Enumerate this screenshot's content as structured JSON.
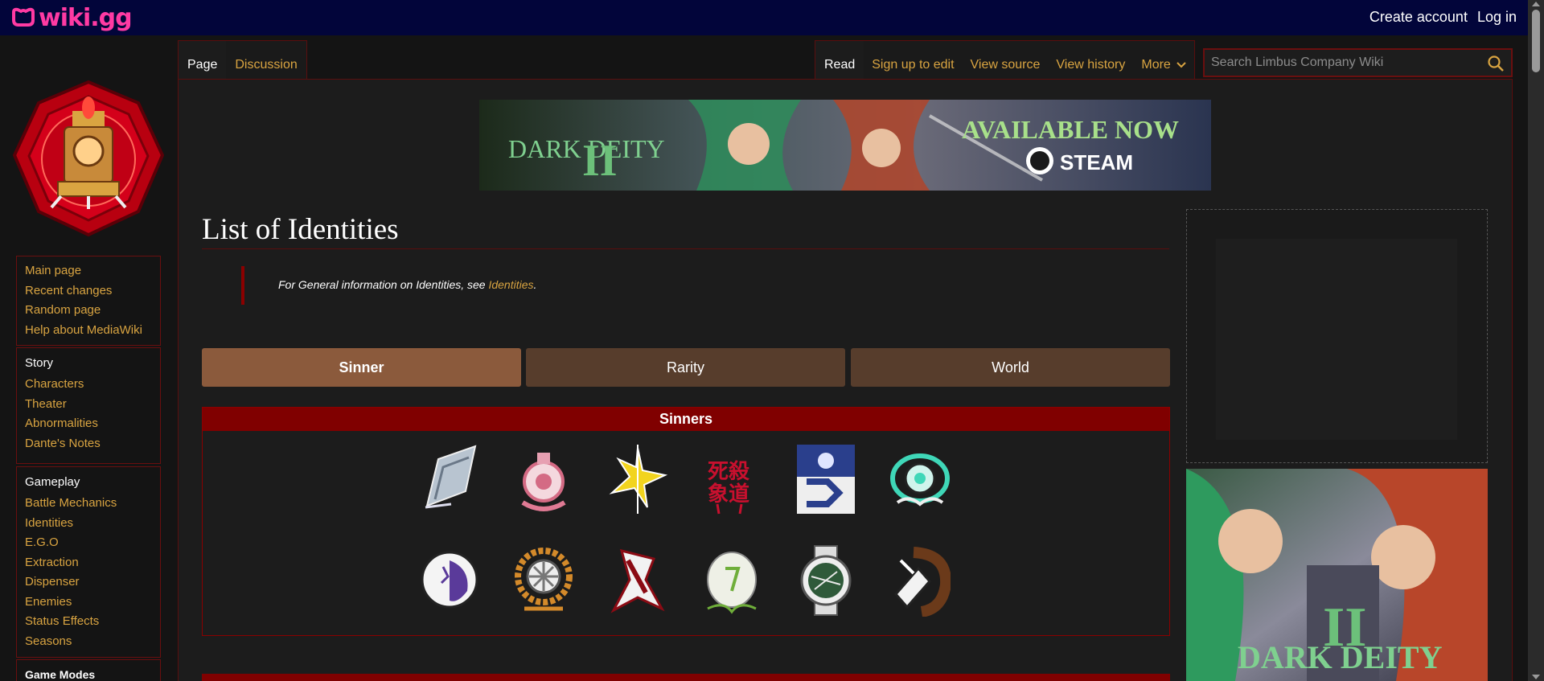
{
  "site": {
    "logo_text": "wiki.gg",
    "brand_color": "#ff3aa3"
  },
  "user_links": {
    "create_account": "Create account",
    "log_in": "Log in"
  },
  "sidebar": {
    "nav": [
      {
        "label": "Main page"
      },
      {
        "label": "Recent changes"
      },
      {
        "label": "Random page"
      },
      {
        "label": "Help about MediaWiki"
      }
    ],
    "story": {
      "heading": "Story",
      "items": [
        {
          "label": "Characters"
        },
        {
          "label": "Theater"
        },
        {
          "label": "Abnormalities"
        },
        {
          "label": "Dante's Notes"
        }
      ]
    },
    "gameplay": {
      "heading": "Gameplay",
      "items": [
        {
          "label": "Battle Mechanics"
        },
        {
          "label": "Identities"
        },
        {
          "label": "E.G.O"
        },
        {
          "label": "Extraction"
        },
        {
          "label": "Dispenser"
        },
        {
          "label": "Enemies"
        },
        {
          "label": "Status Effects"
        },
        {
          "label": "Seasons"
        }
      ]
    },
    "modes": {
      "heading": "Game Modes"
    }
  },
  "tabs": {
    "page": "Page",
    "discussion": "Discussion",
    "read": "Read",
    "sign_up": "Sign up to edit",
    "view_source": "View source",
    "view_history": "View history",
    "more": "More"
  },
  "search": {
    "placeholder": "Search Limbus Company Wiki"
  },
  "banner": {
    "game": "DARK DEITY",
    "numeral": "II",
    "headline": "AVAILABLE NOW",
    "platform": "STEAM"
  },
  "page": {
    "title": "List of Identities",
    "hatnote_prefix": "For General information on Identities, see ",
    "hatnote_link": "Identities",
    "hatnote_suffix": "."
  },
  "filters": {
    "sinner": "Sinner",
    "rarity": "Rarity",
    "world": "World"
  },
  "sinners": {
    "header": "Sinners",
    "icons": [
      "yi-sang-icon",
      "faust-icon",
      "don-quixote-icon",
      "ryoshu-icon",
      "meursault-icon",
      "hong-lu-icon",
      "heathcliff-icon",
      "ishmael-icon",
      "rodion-icon",
      "sinclair-icon",
      "outis-icon",
      "gregor-icon"
    ]
  },
  "colors": {
    "accent_link": "#d9a441",
    "crimson": "#800000",
    "active_filter": "#8b5a3c",
    "inactive_filter": "#573d2c"
  }
}
